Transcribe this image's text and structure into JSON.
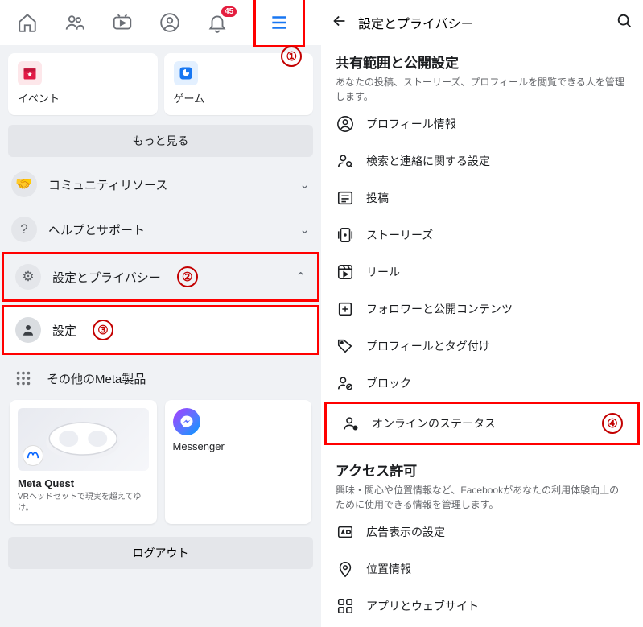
{
  "left": {
    "nav": {
      "notif_badge": "45"
    },
    "shortcuts": {
      "events": "イベント",
      "games": "ゲーム"
    },
    "see_more": "もっと見る",
    "sections": {
      "community": "コミュニティリソース",
      "help": "ヘルプとサポート",
      "settings_privacy": "設定とプライバシー",
      "settings": "設定"
    },
    "other_meta": "その他のMeta製品",
    "meta_quest": {
      "title": "Meta Quest",
      "subtitle": "VRヘッドセットで現実を超えてゆけ。"
    },
    "messenger": "Messenger",
    "logout": "ログアウト",
    "annotations": {
      "one": "①",
      "two": "②",
      "three": "③"
    }
  },
  "right": {
    "header_title": "設定とプライバシー",
    "section1": {
      "title": "共有範囲と公開設定",
      "desc": "あなたの投稿、ストーリーズ、プロフィールを閲覧できる人を管理します。"
    },
    "items": {
      "profile_info": "プロフィール情報",
      "search_contact": "検索と連絡に関する設定",
      "posts": "投稿",
      "stories": "ストーリーズ",
      "reels": "リール",
      "followers": "フォロワーと公開コンテンツ",
      "profile_tag": "プロフィールとタグ付け",
      "block": "ブロック",
      "online_status": "オンラインのステータス"
    },
    "annotation_four": "④",
    "section2": {
      "title": "アクセス許可",
      "desc": "興味・関心や位置情報など、Facebookがあなたの利用体験向上のために使用できる情報を管理します。"
    },
    "items2": {
      "ad_settings": "広告表示の設定",
      "location": "位置情報",
      "apps_sites": "アプリとウェブサイト"
    }
  }
}
